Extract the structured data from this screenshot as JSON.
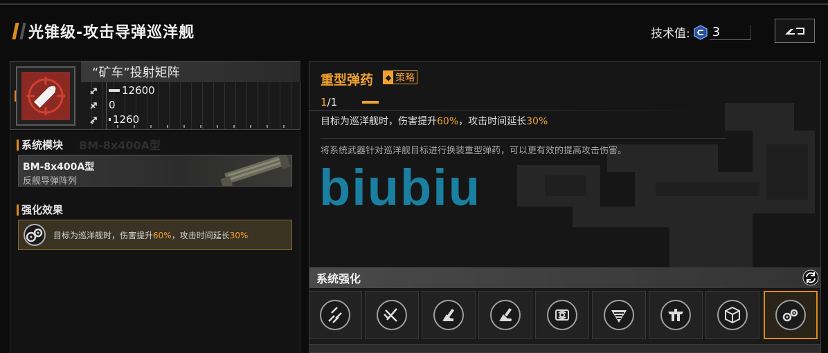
{
  "header": {
    "title": "光锥级-攻击导弹巡洋舰",
    "tech_label": "技术值:",
    "tech_value": "3"
  },
  "weapon": {
    "name": "“矿车”投射矩阵",
    "stats": [
      {
        "icon": "firepower-icon",
        "value": "12600"
      },
      {
        "icon": "antiair-icon",
        "value": "0"
      },
      {
        "icon": "siege-icon",
        "value": "1260"
      }
    ]
  },
  "module_section": {
    "label": "系统模块",
    "ghost": "BM-8x400A型",
    "module_name": "BM-8x400A型",
    "module_sub": "反舰导弹阵列"
  },
  "effect_section": {
    "label": "强化效果",
    "text_a": "目标为巡洋舰时，伤害提升",
    "pct_a": "60%",
    "text_b": "，攻击时间延长",
    "pct_b": "30%"
  },
  "detail": {
    "skill_name": "重型弹药",
    "skill_tag": "策略",
    "level_cur": "1",
    "level_sep": "/",
    "level_max": "1",
    "desc_a": "目标为巡洋舰时，伤害提升",
    "desc_pct_a": "60%",
    "desc_b": "，攻击时间延长",
    "desc_pct_b": "30%",
    "flavor": "将系统武器针对巡洋舰目标进行换装重型弹药，可以更有效的提高攻击伤害。",
    "watermark": "biubiu"
  },
  "system": {
    "header": "系统强化",
    "prev_glyph": "‹",
    "slots": [
      {
        "name": "slot-missile-salvo"
      },
      {
        "name": "slot-missile-pair"
      },
      {
        "name": "slot-launcher-a"
      },
      {
        "name": "slot-launcher-b"
      },
      {
        "name": "slot-radar-module"
      },
      {
        "name": "slot-shield-emblem"
      },
      {
        "name": "slot-turret-emblem"
      },
      {
        "name": "slot-armor-cube"
      },
      {
        "name": "slot-heavy-ammo"
      }
    ],
    "selected_index": 8
  },
  "colors": {
    "accent": "#f0a030",
    "weapon_icon_bg": "#8b2a22",
    "watermark": "#1a7fa0",
    "tech_icon": "#4a7ad8"
  }
}
